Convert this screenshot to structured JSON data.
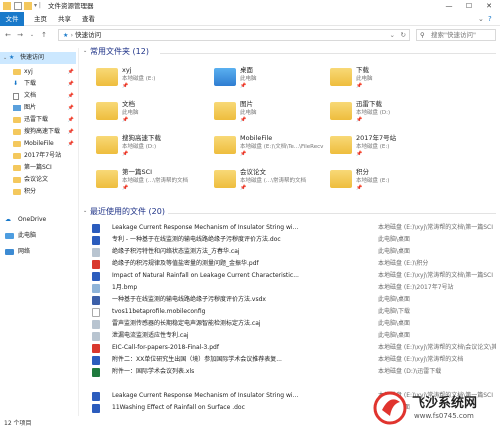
{
  "window": {
    "title": "文件资源管理器"
  },
  "ribbon": {
    "tabs": [
      "文件",
      "主页",
      "共享",
      "查看"
    ]
  },
  "address": {
    "path": "快速访问",
    "search_placeholder": "搜索\"快速访问\""
  },
  "sidebar": {
    "items": [
      {
        "label": "快速访问",
        "icon": "star-icon",
        "selected": true
      },
      {
        "label": "xyj",
        "icon": "folder-icon"
      },
      {
        "label": "下载",
        "icon": "download-icon"
      },
      {
        "label": "文档",
        "icon": "document-icon"
      },
      {
        "label": "图片",
        "icon": "picture-icon"
      },
      {
        "label": "迅雷下载",
        "icon": "folder-icon"
      },
      {
        "label": "搜狗高速下载",
        "icon": "folder-icon"
      },
      {
        "label": "MobileFile",
        "icon": "folder-icon"
      },
      {
        "label": "2017年7号站",
        "icon": "folder-icon"
      },
      {
        "label": "第一篇SCI",
        "icon": "folder-icon"
      },
      {
        "label": "会议论文",
        "icon": "folder-icon"
      },
      {
        "label": "积分",
        "icon": "folder-icon"
      },
      {
        "label": "OneDrive",
        "icon": "cloud-icon"
      },
      {
        "label": "此电脑",
        "icon": "computer-icon"
      },
      {
        "label": "网络",
        "icon": "network-icon"
      }
    ]
  },
  "frequent": {
    "title": "常用文件夹 (12)",
    "folders": [
      {
        "name": "xyj",
        "location": "本地磁盘 (E:)"
      },
      {
        "name": "桌面",
        "location": "此电脑"
      },
      {
        "name": "下载",
        "location": "此电脑"
      },
      {
        "name": "文档",
        "location": "此电脑"
      },
      {
        "name": "图片",
        "location": "此电脑"
      },
      {
        "name": "迅雷下载",
        "location": "本地磁盘 (D:)"
      },
      {
        "name": "搜狗高速下载",
        "location": "本地磁盘 (D:)"
      },
      {
        "name": "MobileFile",
        "location": "本地磁盘 (E:)\\文档\\Te...\\FileRecv"
      },
      {
        "name": "2017年7号站",
        "location": "本地磁盘 (E:)"
      },
      {
        "name": "第一篇SCI",
        "location": "本地磁盘 (...\\常涛帮的文档"
      },
      {
        "name": "会议论文",
        "location": "本地磁盘 (...\\常涛帮的文档"
      },
      {
        "name": "积分",
        "location": "本地磁盘 (E:)"
      }
    ]
  },
  "recent": {
    "title": "最近使用的文件 (20)",
    "files": [
      {
        "name": "Leakage Current Response Mechanism of Insulator String wi...",
        "location": "本地磁盘 (E:)\\xyj\\常涛帮的文档\\第一篇SCI"
      },
      {
        "name": "专利 - 一种基于在线监测的输电线路绝缘子污秽度评价方法.doc",
        "location": "此电脑\\桌面"
      },
      {
        "name": "绝缘子积污特性和闪络状态监测方法_方春华.caj",
        "location": "此电脑\\桌面"
      },
      {
        "name": "绝缘子的积污规律及等值盐密量的测量问题_金振华.pdf",
        "location": "本地磁盘 (E:)\\积分"
      },
      {
        "name": "Impact of Natural Rainfall on Leakage Current Characteristic...",
        "location": "本地磁盘 (E:)\\xyj\\常涛帮的文档\\第一篇SCI"
      },
      {
        "name": "1月.bmp",
        "location": "本地磁盘 (E:)\\2017年7号站"
      },
      {
        "name": "一种基于在线监测的输电线路绝缘子污秽度评价方法.vsdx",
        "location": "此电脑\\桌面"
      },
      {
        "name": "tvos11betaprofile.mobileconfig",
        "location": "此电脑\\下载"
      },
      {
        "name": "雷声监测传感器的长期稳定电声源智能检测标定方法.caj",
        "location": "此电脑\\桌面"
      },
      {
        "name": "泄漏电流监测适应性专利.caj",
        "location": "此电脑\\桌面"
      },
      {
        "name": "EIC-Call-for-papers-2018-Final-3.pdf",
        "location": "本地磁盘 (E:)\\xyj\\常涛帮的文档\\会议论文\\其他会议"
      },
      {
        "name": "附件二：XX单位研究生出国（境）参加国际学术会议推荐表复...",
        "location": "本地磁盘 (E:)\\xyj\\常涛帮的文档"
      },
      {
        "name": "附件一：国际学术会议列表.xls",
        "location": "本地磁盘 (D:)\\迅雷下载"
      },
      {
        "name": "Leakage Current Response Mechanism of Insulator String wi...",
        "location": "本地磁盘 (E:)\\xyj\\常涛帮的文档\\第一篇SCI"
      },
      {
        "name": "11Washing Effect of Rainfall on Surface .doc",
        "location": "此电脑\\桌面"
      }
    ]
  },
  "status": {
    "count": "12 个项目"
  },
  "watermark": {
    "text": "飞沙系统网",
    "url": "www.fs0745.com"
  },
  "colors": {
    "accent": "#1979ca",
    "selected": "#cce8ff",
    "section": "#1e3287",
    "watermark": "#e0342e"
  }
}
